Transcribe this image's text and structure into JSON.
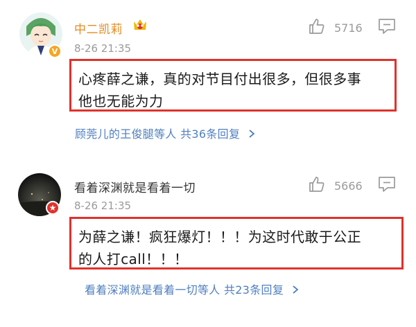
{
  "comments": [
    {
      "username": "中二凯莉",
      "time": "8-26 21:35",
      "likes": "5716",
      "content": [
        "心疼薛之谦，真的对节目付出很多，但很多事",
        "他也无能为力"
      ],
      "replies": "顾莞儿的王俊腿等人 共36条回复",
      "badge_icon": "verified-v-icon",
      "username_color": "#e58a1f"
    },
    {
      "username": "看着深渊就是看着一切",
      "time": "8-26 21:35",
      "likes": "5666",
      "content": [
        "为薛之谦！疯狂爆灯！！！为这时代敢于公正",
        "的人打call！！！"
      ],
      "replies": "看着深渊就是看着一切等人 共23条回复",
      "badge_icon": "star-badge-icon",
      "username_color": "#333333"
    }
  ]
}
